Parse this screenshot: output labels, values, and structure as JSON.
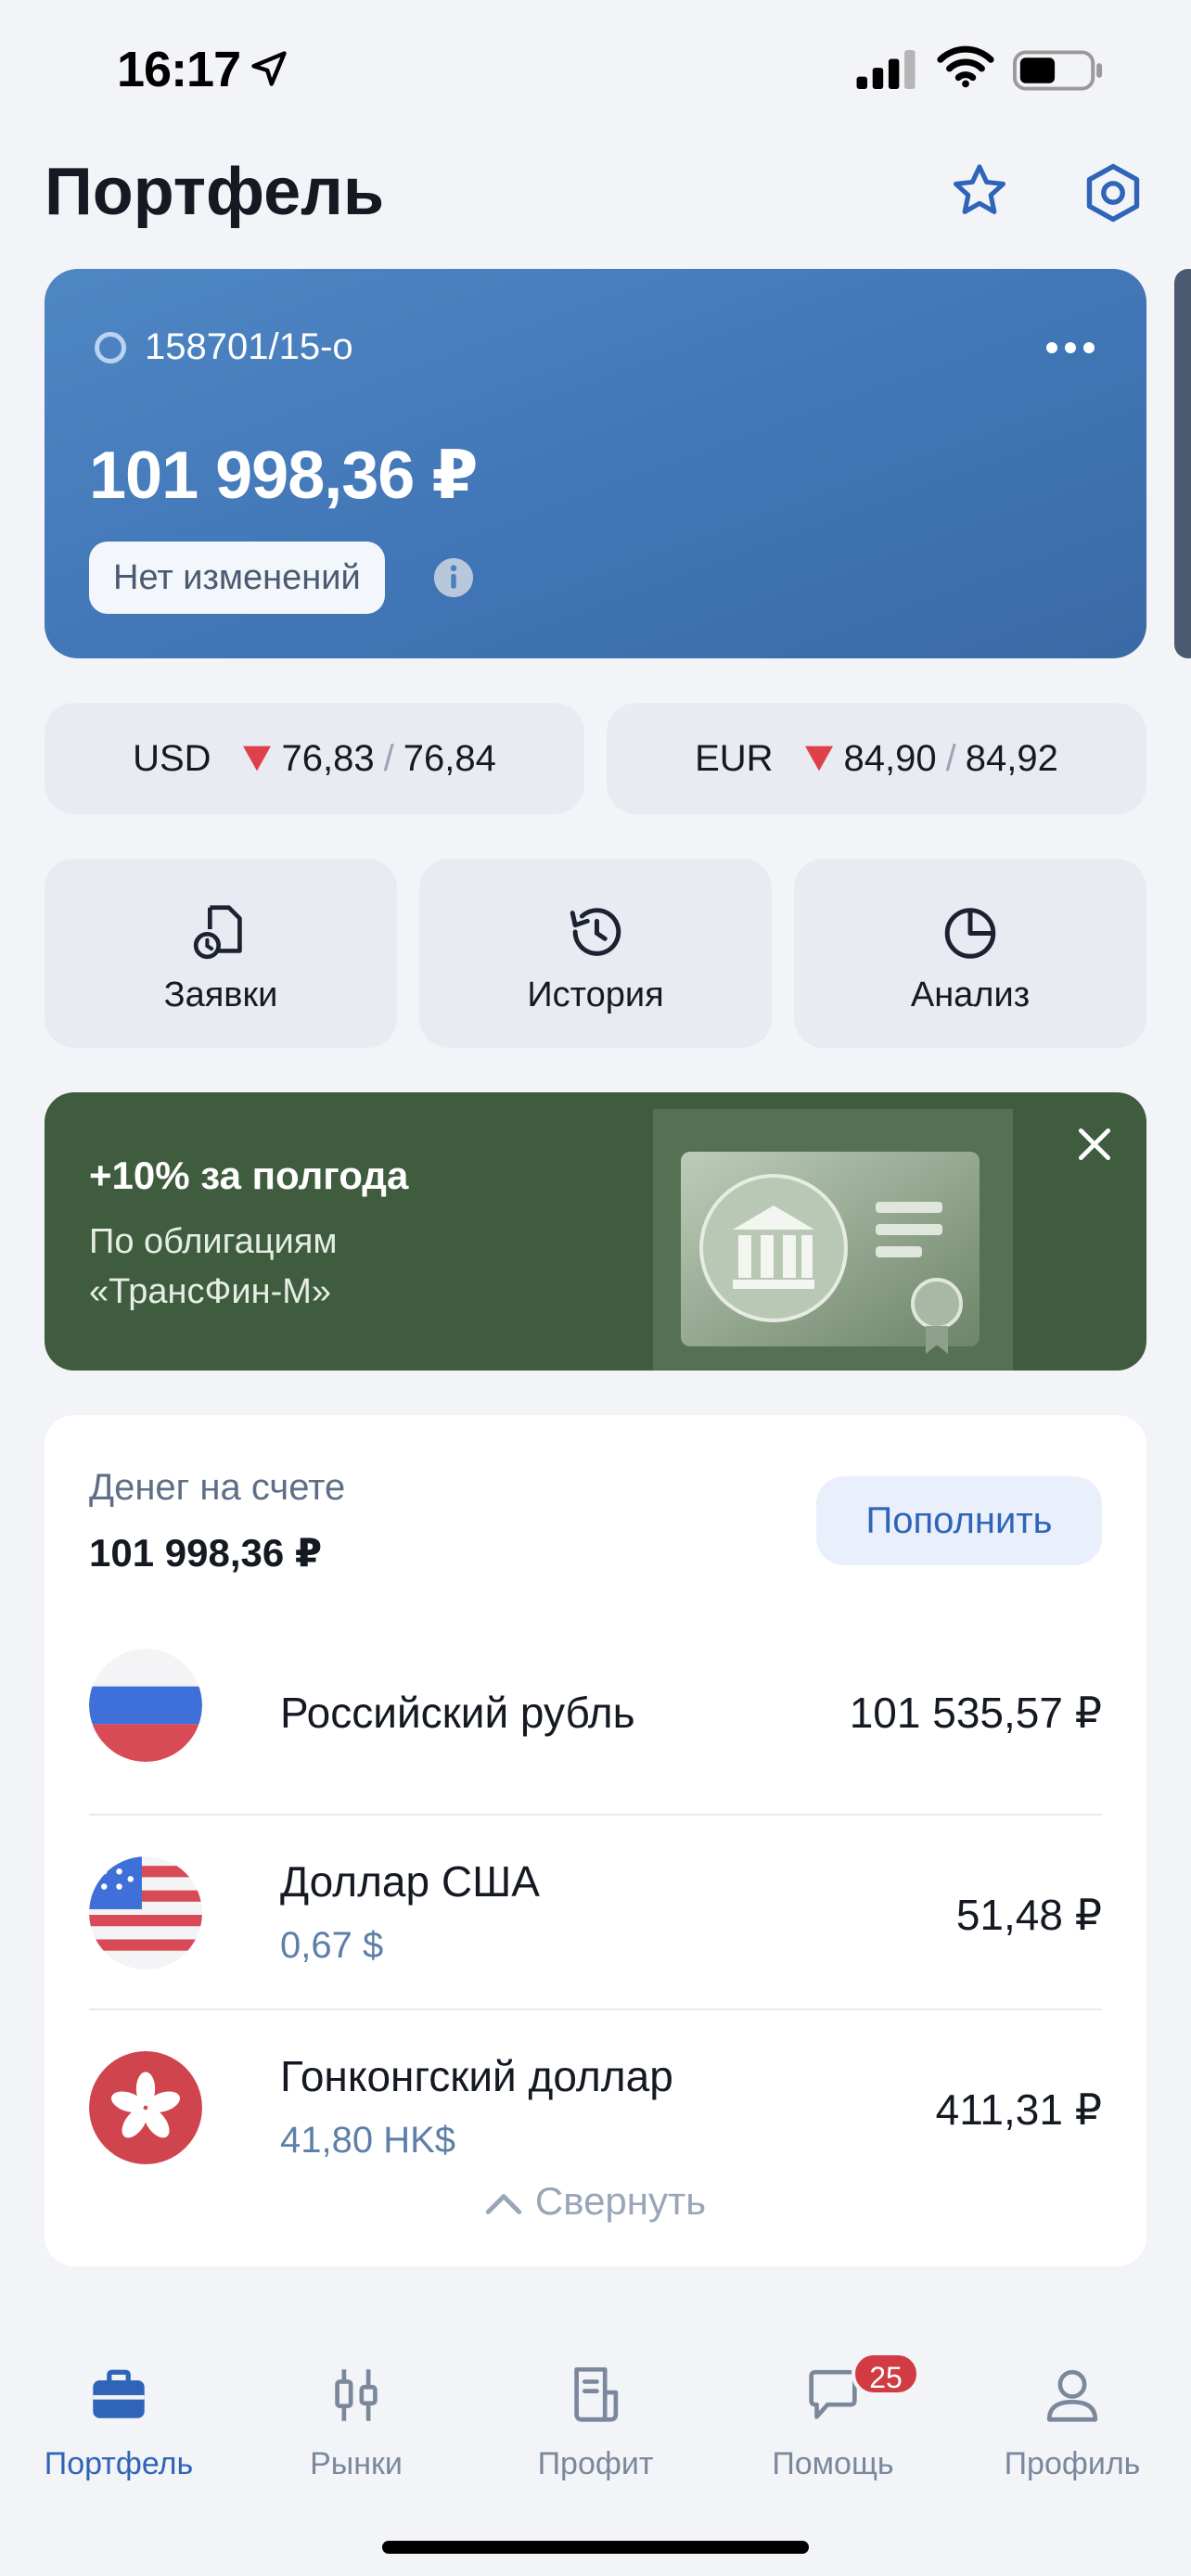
{
  "status": {
    "time": "16:17"
  },
  "header": {
    "title": "Портфель"
  },
  "account": {
    "number": "158701/15-о",
    "balance": "101 998,36 ₽",
    "change_label": "Нет изменений"
  },
  "rates": [
    {
      "currency": "USD",
      "buy": "76,83",
      "sep": "/",
      "sell": "76,84",
      "direction": "down"
    },
    {
      "currency": "EUR",
      "buy": "84,90",
      "sep": "/",
      "sell": "84,92",
      "direction": "down"
    }
  ],
  "actions": [
    {
      "label": "Заявки",
      "icon": "orders-icon"
    },
    {
      "label": "История",
      "icon": "history-icon"
    },
    {
      "label": "Анализ",
      "icon": "pie-chart-icon"
    }
  ],
  "promo": {
    "title": "+10% за полгода",
    "text": "По облигациям «ТрансФин-М»"
  },
  "cash": {
    "label": "Денег на счете",
    "total": "101 998,36 ₽",
    "topup_label": "Пополнить",
    "currencies": [
      {
        "name": "Российский рубль",
        "sub": "",
        "value": "101 535,57 ₽",
        "flag": "russia-flag-icon"
      },
      {
        "name": "Доллар США",
        "sub": "0,67 $",
        "value": "51,48 ₽",
        "flag": "usa-flag-icon"
      },
      {
        "name": "Гонконгский доллар",
        "sub": "41,80 HK$",
        "value": "411,31 ₽",
        "flag": "hong-kong-flag-icon"
      }
    ],
    "collapse_label": "Свернуть"
  },
  "tabbar": {
    "items": [
      {
        "label": "Портфель",
        "icon": "briefcase-icon",
        "active": true
      },
      {
        "label": "Рынки",
        "icon": "candles-icon",
        "active": false
      },
      {
        "label": "Профит",
        "icon": "news-icon",
        "active": false
      },
      {
        "label": "Помощь",
        "icon": "chat-icon",
        "active": false,
        "badge": "25"
      },
      {
        "label": "Профиль",
        "icon": "profile-icon",
        "active": false
      }
    ]
  },
  "colors": {
    "accent": "#2f64b8",
    "card_blue": "#4a7fbf",
    "promo_green": "#3f5c3e",
    "down_red": "#e0404a",
    "badge_red": "#d23b44"
  }
}
